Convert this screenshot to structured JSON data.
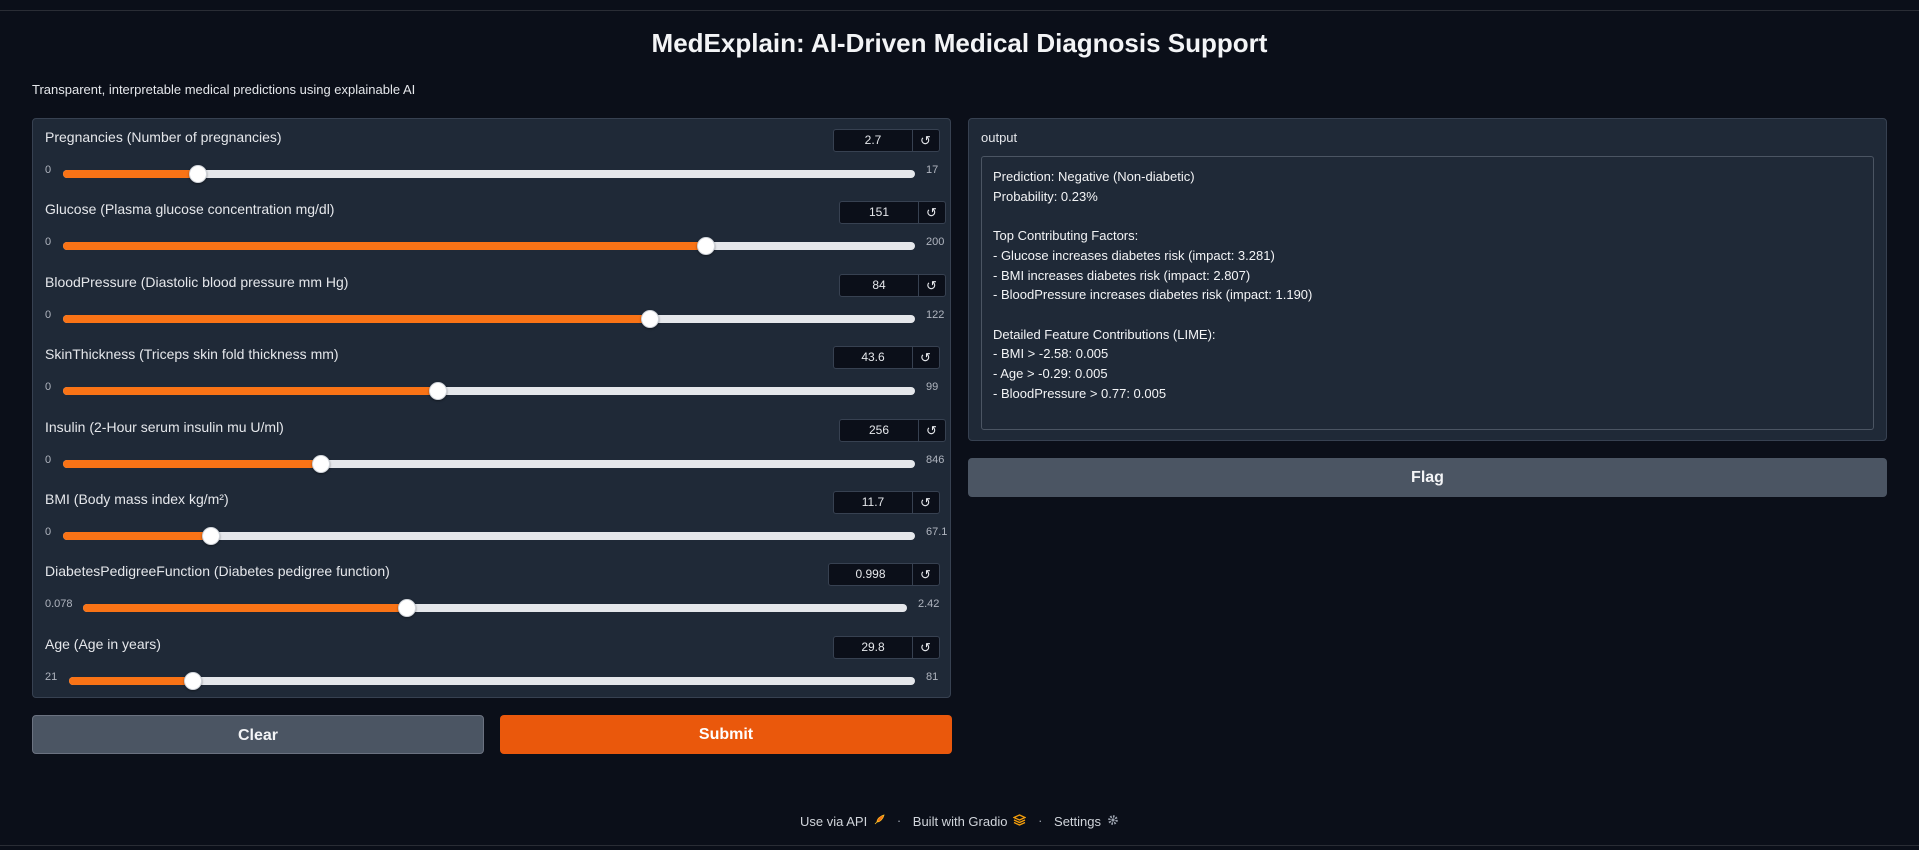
{
  "app": {
    "title": "MedExplain: AI-Driven Medical Diagnosis Support",
    "subtitle": "Transparent, interpretable medical predictions using explainable AI"
  },
  "inputs": [
    {
      "label": "Pregnancies (Number of pregnancies)",
      "value": "2.7",
      "min": "0",
      "max": "17",
      "fraction": 0.159
    },
    {
      "label": "Glucose (Plasma glucose concentration mg/dl)",
      "value": "151",
      "min": "0",
      "max": "200",
      "fraction": 0.755
    },
    {
      "label": "BloodPressure (Diastolic blood pressure mm Hg)",
      "value": "84",
      "min": "0",
      "max": "122",
      "fraction": 0.689
    },
    {
      "label": "SkinThickness (Triceps skin fold thickness mm)",
      "value": "43.6",
      "min": "0",
      "max": "99",
      "fraction": 0.44
    },
    {
      "label": "Insulin (2-Hour serum insulin mu U/ml)",
      "value": "256",
      "min": "0",
      "max": "846",
      "fraction": 0.303
    },
    {
      "label": "BMI (Body mass index kg/m²)",
      "value": "11.7",
      "min": "0",
      "max": "67.1",
      "fraction": 0.174
    },
    {
      "label": "DiabetesPedigreeFunction (Diabetes pedigree function)",
      "value": "0.998",
      "min": "0.078",
      "max": "2.42",
      "fraction": 0.393
    },
    {
      "label": "Age (Age in years)",
      "value": "29.8",
      "min": "21",
      "max": "81",
      "fraction": 0.147
    }
  ],
  "reset_icon": "↺",
  "buttons": {
    "clear": "Clear",
    "submit": "Submit",
    "flag": "Flag"
  },
  "output": {
    "label": "output",
    "text": "Prediction: Negative (Non-diabetic)\nProbability: 0.23%\n\nTop Contributing Factors:\n- Glucose increases diabetes risk (impact: 3.281)\n- BMI increases diabetes risk (impact: 2.807)\n- BloodPressure increases diabetes risk (impact: 1.190)\n\nDetailed Feature Contributions (LIME):\n- BMI > -2.58: 0.005\n- Age > -0.29: 0.005\n- BloodPressure > 0.77: 0.005"
  },
  "footer": {
    "api": "Use via API",
    "api_icon": "rocket-icon",
    "built": "Built with Gradio",
    "built_icon": "gradio-logo-icon",
    "settings": "Settings",
    "settings_icon": "gear-icon",
    "separator": "·"
  },
  "colors": {
    "accent": "#f97316",
    "background": "#0b0f19",
    "panel": "#1f2937"
  }
}
